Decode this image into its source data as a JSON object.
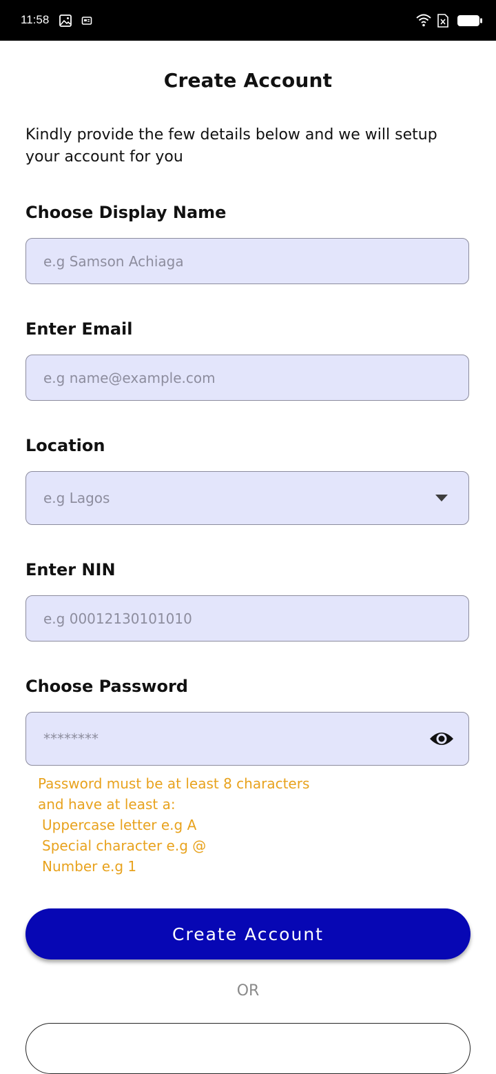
{
  "status_bar": {
    "time": "11:58",
    "icons": [
      "image-icon",
      "notification-icon",
      "wifi-icon",
      "no-sim-icon",
      "battery-icon"
    ]
  },
  "page": {
    "title": "Create Account",
    "intro": "Kindly provide the few details below and we will setup your account for you"
  },
  "form": {
    "display_name": {
      "label": "Choose Display Name",
      "placeholder": "e.g Samson Achiaga",
      "value": ""
    },
    "email": {
      "label": "Enter Email",
      "placeholder": "e.g name@example.com",
      "value": ""
    },
    "location": {
      "label": "Location",
      "placeholder": "e.g Lagos",
      "value": "",
      "icon": "chevron-down-icon"
    },
    "nin": {
      "label": "Enter NIN",
      "placeholder": "e.g 00012130101010",
      "value": ""
    },
    "password": {
      "label": "Choose Password",
      "placeholder": "********",
      "value": "",
      "icon": "eye-icon"
    },
    "password_hint": {
      "line1": "Password must be at least 8 characters",
      "line2": "and have at least a:",
      "req1": "Uppercase letter e.g A",
      "req2": "Special character e.g @",
      "req3": "Number e.g 1"
    }
  },
  "actions": {
    "create_account": "Create Account",
    "or": "OR"
  },
  "colors": {
    "status_bar": "#000000",
    "field_background": "#e3e5fb",
    "hint_text": "#e8a21d",
    "primary_button": "#0707b4"
  }
}
